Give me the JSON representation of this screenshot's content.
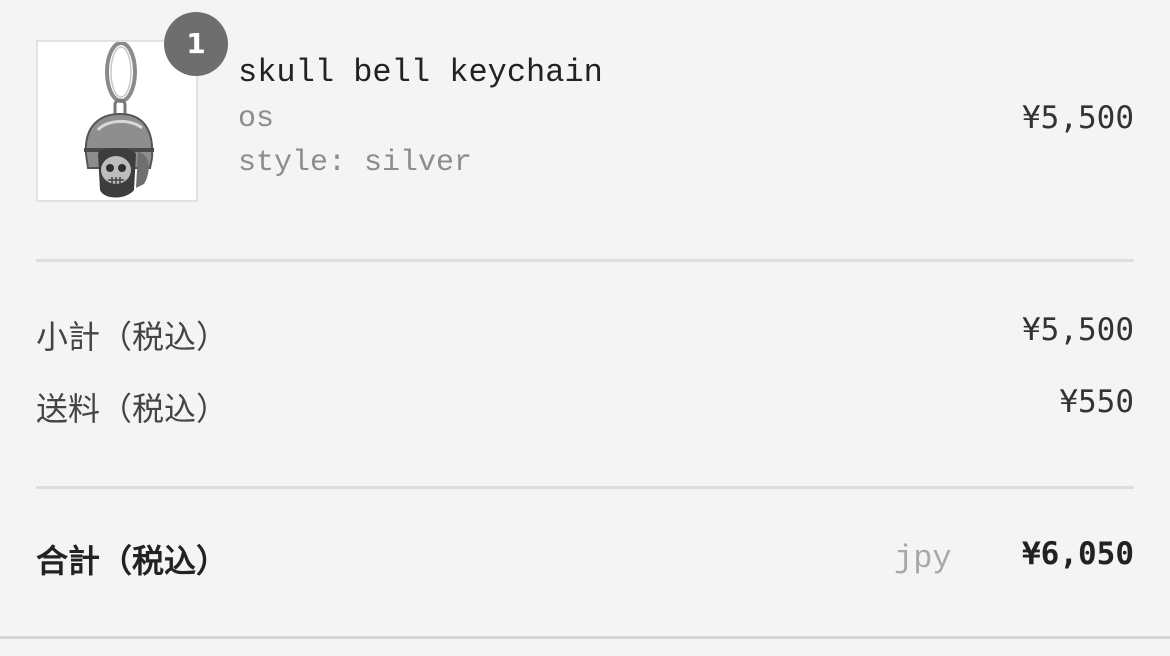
{
  "item": {
    "quantity": "1",
    "title": "skull bell keychain",
    "variant": "os",
    "style": "style: silver",
    "price": "¥5,500",
    "image_icon": "skull-bell-keychain-image"
  },
  "summary": {
    "subtotal_label": "小計（税込）",
    "subtotal_value": "¥5,500",
    "shipping_label": "送料（税込）",
    "shipping_value": "¥550",
    "total_label": "合計（税込）",
    "currency": "jpy",
    "total_value": "¥6,050"
  },
  "colors": {
    "background": "#f4f4f4",
    "badge": "#6e6e6e",
    "muted_text": "#8d8d8d",
    "divider": "#dedede"
  }
}
